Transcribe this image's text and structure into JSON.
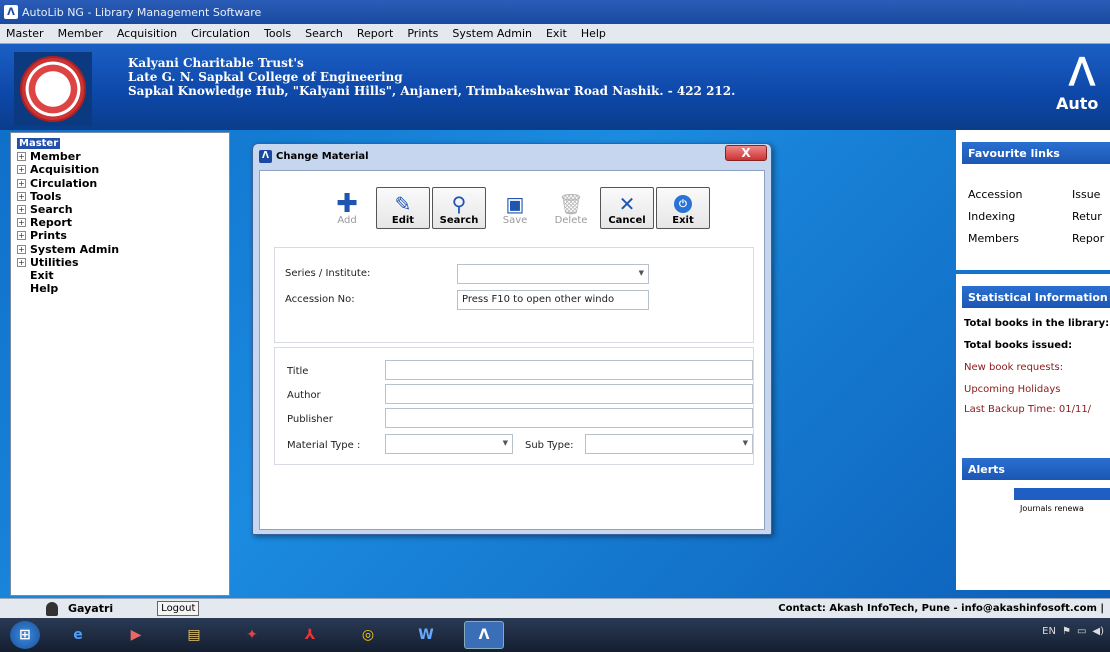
{
  "window": {
    "title": "AutoLib NG - Library Management Software"
  },
  "menu": [
    "Master",
    "Member",
    "Acquisition",
    "Circulation",
    "Tools",
    "Search",
    "Report",
    "Prints",
    "System Admin",
    "Exit",
    "Help"
  ],
  "banner": {
    "line1": "Kalyani Charitable Trust's",
    "line2": "Late G. N. Sapkal College of Engineering",
    "line3": "Sapkal Knowledge Hub, \"Kalyani Hills\", Anjaneri, Trimbakeshwar Road Nashik. - 422 212.",
    "brand_text": "Auto"
  },
  "tree": [
    {
      "label": "Master",
      "expandable": true,
      "selected": true
    },
    {
      "label": "Member",
      "expandable": true
    },
    {
      "label": "Acquisition",
      "expandable": true
    },
    {
      "label": "Circulation",
      "expandable": true
    },
    {
      "label": "Tools",
      "expandable": true
    },
    {
      "label": "Search",
      "expandable": true
    },
    {
      "label": "Report",
      "expandable": true
    },
    {
      "label": "Prints",
      "expandable": true
    },
    {
      "label": "System Admin",
      "expandable": true
    },
    {
      "label": "Utilities",
      "expandable": true
    },
    {
      "label": "Exit",
      "expandable": false
    },
    {
      "label": "Help",
      "expandable": false
    }
  ],
  "dialog": {
    "title": "Change Material",
    "close_label": "X",
    "toolbar": {
      "add": "Add",
      "edit": "Edit",
      "search": "Search",
      "save": "Save",
      "delete": "Delete",
      "cancel": "Cancel",
      "exit": "Exit"
    },
    "series_label": "Series / Institute:",
    "series_value": "",
    "accession_label": "Accession No:",
    "accession_value": "Press F10 to open other windo",
    "title_label": "Title",
    "author_label": "Author",
    "publisher_label": "Publisher",
    "material_type_label": "Material Type :",
    "sub_type_label": "Sub Type:"
  },
  "favourites": {
    "header": "Favourite links",
    "col1": [
      "Accession",
      "Indexing",
      "Members"
    ],
    "col2": [
      "Issue",
      "Retur",
      "Repor"
    ]
  },
  "stats": {
    "header": "Statistical Information",
    "lines": [
      "Total books in the library:",
      "Total books issued:",
      "New book requests:",
      "Upcoming Holidays",
      "Last Backup Time: 01/11/"
    ]
  },
  "alerts": {
    "header": "Alerts",
    "item": "Journals renewa"
  },
  "status": {
    "user": "Gayatri",
    "logout": "Logout",
    "contact": "Contact: Akash InfoTech, Pune - info@akashinfosoft.com |"
  },
  "taskbar": {
    "tray_lang": "EN"
  }
}
